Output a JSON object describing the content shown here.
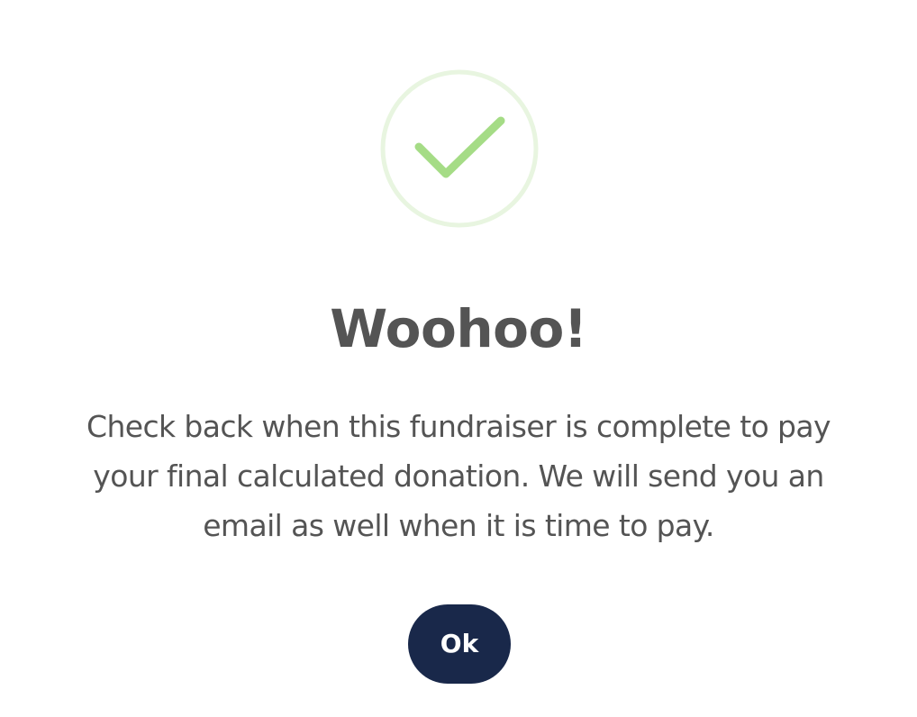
{
  "dialog": {
    "icon": "checkmark-success-icon",
    "title": "Woohoo!",
    "message": "Check back when this fundraiser is complete to pay your final calculated donation. We will send you an email as well when it is time to pay.",
    "ok_label": "Ok"
  },
  "colors": {
    "check_stroke": "#a5dc86",
    "ring_stroke": "#e8f5e0",
    "text": "#545454",
    "button_bg": "#19284a",
    "button_text": "#ffffff"
  }
}
